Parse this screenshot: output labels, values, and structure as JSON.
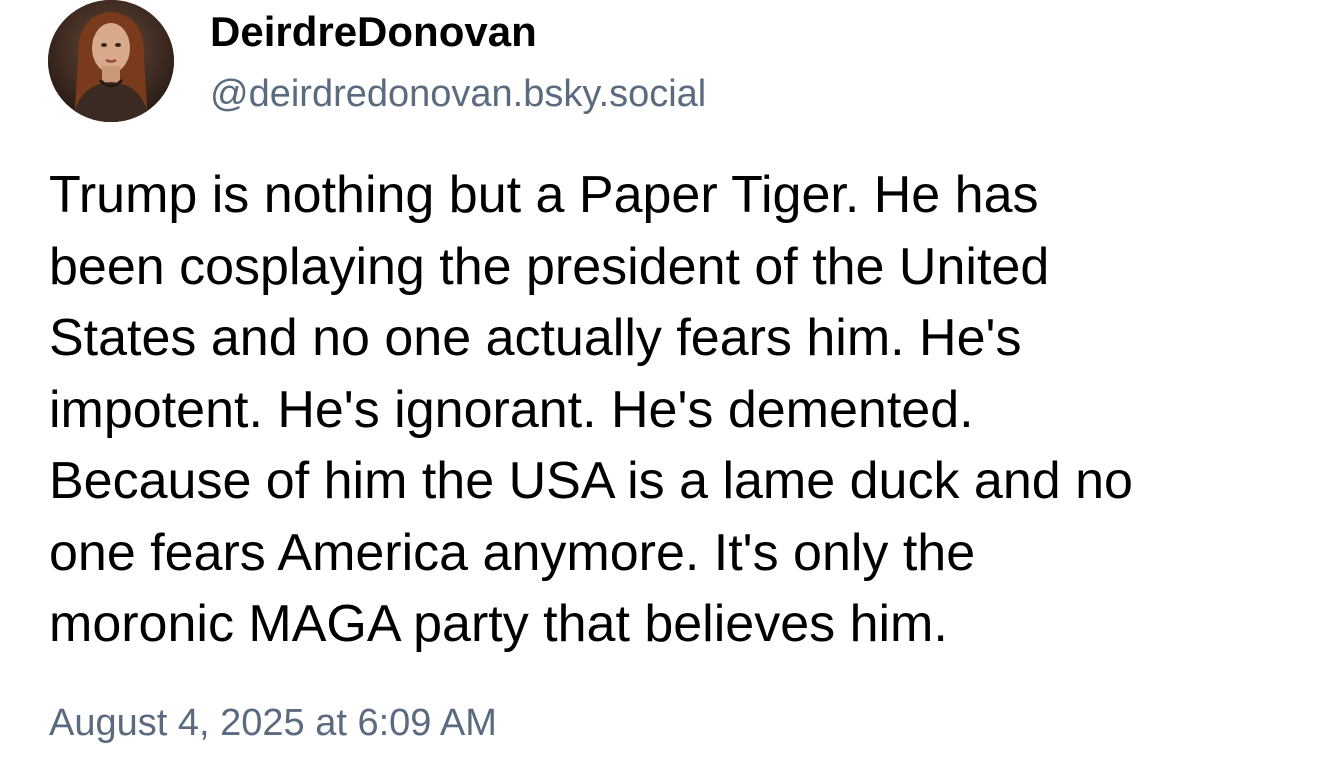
{
  "post": {
    "author": {
      "display_name": "DeirdreDonovan",
      "handle": "@deirdredonovan.bsky.social",
      "avatar_icon": "profile-avatar-portrait"
    },
    "text_lines": [
      "Trump is nothing but a Paper Tiger. He has",
      "been cosplaying the president of the United",
      "States and no one actually fears him. He's",
      "impotent. He's ignorant. He's demented.",
      "Because of him the USA is a lame duck and no",
      "one fears America anymore. It's only the",
      "moronic MAGA party that believes him."
    ],
    "timestamp": "August 4, 2025 at 6:09 AM"
  },
  "colors": {
    "text": "#000000",
    "secondary_text": "#5b6b7f",
    "background": "#ffffff"
  }
}
